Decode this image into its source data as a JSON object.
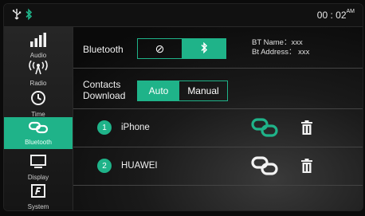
{
  "status_bar": {
    "icons": [
      "usb-icon",
      "bluetooth-icon"
    ],
    "time": "00 : 02",
    "ampm": "AM"
  },
  "sidebar": {
    "items": [
      {
        "label": "Audio",
        "icon": "equalizer-icon"
      },
      {
        "label": "Radio",
        "icon": "radio-antenna-icon"
      },
      {
        "label": "Time",
        "icon": "clock-icon"
      },
      {
        "label": "Bluetooth",
        "icon": "link-icon",
        "active": true
      },
      {
        "label": "Display",
        "icon": "monitor-icon"
      },
      {
        "label": "System",
        "icon": "system-icon"
      }
    ]
  },
  "bluetooth_row": {
    "label": "Bluetooth",
    "off_symbol": "⊘",
    "on_symbol": "bluetooth",
    "bt_name": "BT Name：xxx",
    "bt_address": "Bt Address： xxx"
  },
  "contacts_row": {
    "label_line1": "Contacts",
    "label_line2": "Download",
    "option_auto": "Auto",
    "option_manual": "Manual",
    "selected": "Auto"
  },
  "devices": [
    {
      "number": "1",
      "name": "iPhone",
      "connected": true
    },
    {
      "number": "2",
      "name": "HUAWEI",
      "connected": false
    }
  ],
  "colors": {
    "accent": "#1fb389",
    "text": "#f0f0f0"
  }
}
